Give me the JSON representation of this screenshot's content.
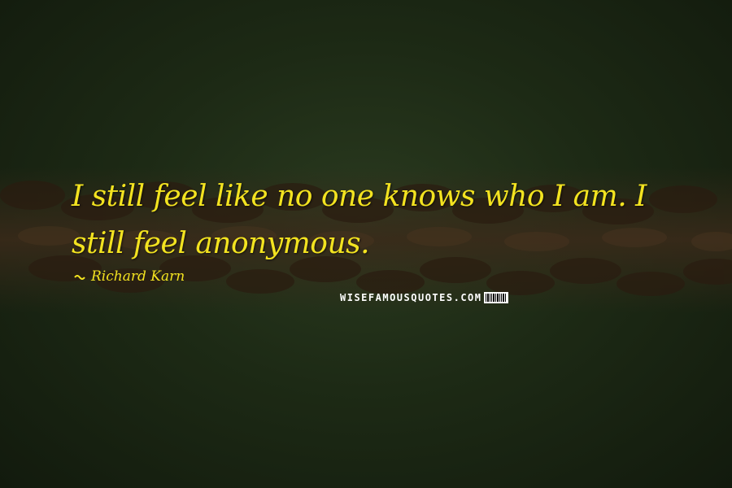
{
  "quote": {
    "text": "I still feel like no one knows who I am. I still feel anonymous.",
    "author": "Richard Karn"
  },
  "watermark": {
    "text": "WISEFAMOUSQUOTES.COM"
  },
  "colors": {
    "quote_text": "#f3e320",
    "background": "#1d2a15"
  },
  "icons": {
    "author_prefix": "quote-dash-icon",
    "watermark_logo": "barcode-icon"
  }
}
